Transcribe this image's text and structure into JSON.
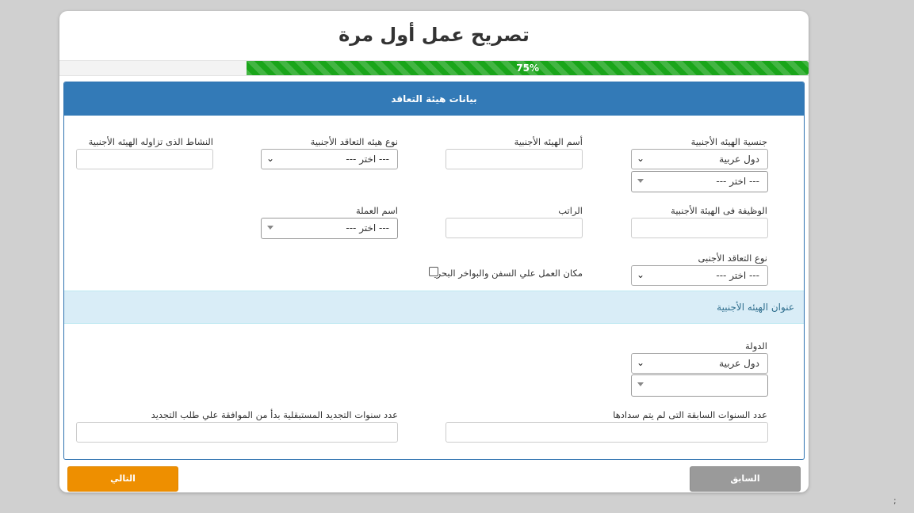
{
  "page": {
    "title": "تصريح عمل أول مرة",
    "corner_mark": ";"
  },
  "progress": {
    "value": 75,
    "label": "75%"
  },
  "panel": {
    "heading": "بيانات هيئة التعاقد",
    "fields": {
      "nationality_label": "جنسية الهيئه الأجنبية",
      "nationality_value": "دول عربية",
      "nationality_sub_value": "--- اختر ---",
      "entity_name_label": "أسم الهيئه الأجنبية",
      "entity_type_label": "نوع هيئه التعاقد الأجنبية",
      "entity_type_value": "--- اختر ---",
      "activity_label": "النشاط الذى تزاوله الهيئه الأجنبية",
      "job_label": "الوظيفة فى الهيئة الأجنبية",
      "salary_label": "الراتب",
      "currency_label": "اسم العملة",
      "currency_value": "--- اختر ---",
      "contract_type_label": "نوع التعاقد الأجنبى",
      "contract_type_value": "--- اختر ---",
      "ship_work_label": "مكان العمل علي السفن والبواخر البحرية"
    },
    "address_heading": "عنوان الهيئه الأجنبية",
    "address": {
      "country_label": "الدولة",
      "country_value": "دول عربية",
      "previous_years_label": "عدد السنوات السابقة التى لم يتم سدادها",
      "future_years_label": "عدد سنوات التجديد المستبقلية بدأ من الموافقة علي طلب التجديد"
    }
  },
  "buttons": {
    "previous": "السابق",
    "next": "التالي"
  }
}
